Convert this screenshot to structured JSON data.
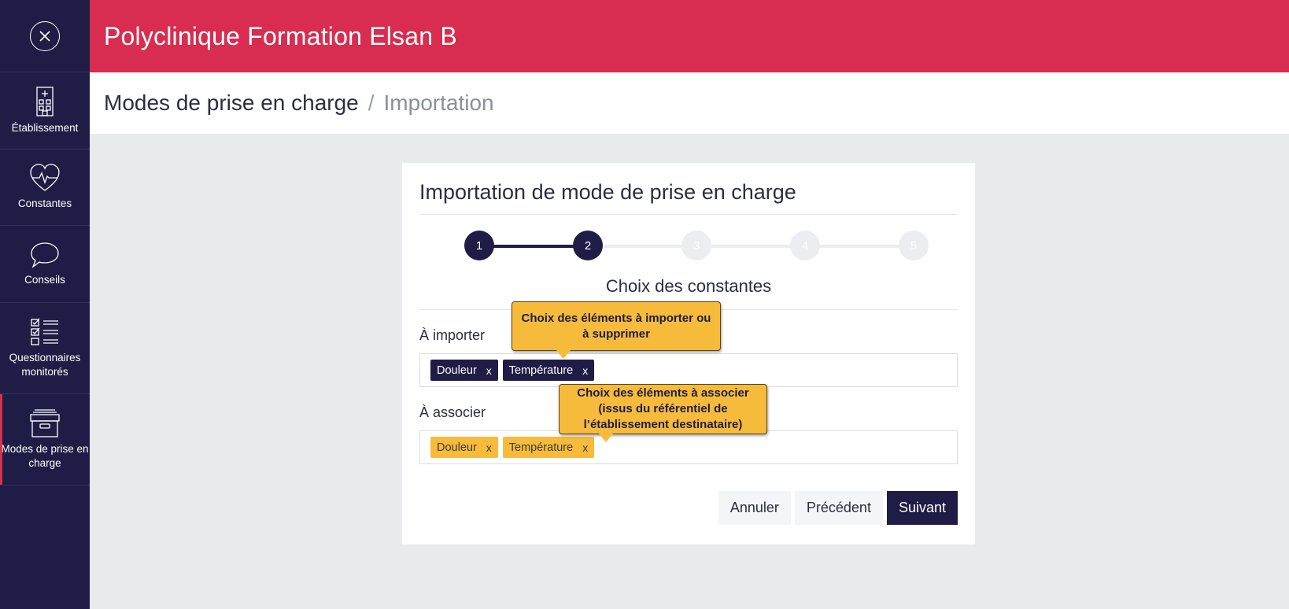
{
  "header": {
    "app_title": "Polyclinique Formation Elsan B"
  },
  "breadcrumb": {
    "section": "Modes de prise en charge",
    "separator": "/",
    "current": "Importation"
  },
  "sidebar": {
    "close_icon": "close-circle-icon",
    "items": [
      {
        "label": "Établissement",
        "icon": "hospital-building-icon"
      },
      {
        "label": "Constantes",
        "icon": "heart-pulse-icon"
      },
      {
        "label": "Conseils",
        "icon": "speech-bubble-icon"
      },
      {
        "label": "Questionnaires monitorés",
        "icon": "checklist-icon"
      },
      {
        "label": "Modes de prise en charge",
        "icon": "archive-box-icon",
        "active": true
      }
    ]
  },
  "card": {
    "title": "Importation de mode de prise en charge",
    "steps": [
      {
        "number": "1",
        "status": "done"
      },
      {
        "number": "2",
        "status": "current"
      },
      {
        "number": "3",
        "status": "pending"
      },
      {
        "number": "4",
        "status": "pending"
      },
      {
        "number": "5",
        "status": "pending"
      }
    ],
    "step_label": "Choix des constantes",
    "import_field": {
      "label": "À importer",
      "tags": [
        {
          "text": "Douleur",
          "remove": "x"
        },
        {
          "text": "Température",
          "remove": "x"
        }
      ]
    },
    "associate_field": {
      "label": "À associer",
      "tags": [
        {
          "text": "Douleur",
          "remove": "x"
        },
        {
          "text": "Température",
          "remove": "x"
        }
      ]
    },
    "buttons": {
      "cancel": "Annuler",
      "previous": "Précédent",
      "next": "Suivant"
    }
  },
  "callouts": {
    "import_hint": {
      "line1": "Choix des éléments à importer ou",
      "line2": "à supprimer"
    },
    "associate_hint": {
      "line1": "Choix des éléments à associer",
      "line2": "(issus du référentiel de",
      "line3": "l’établissement destinataire)"
    }
  },
  "colors": {
    "brand_red": "#d82d50",
    "navy": "#1f1c45",
    "tag_yellow": "#f7bb3b",
    "background": "#e8ebee"
  }
}
